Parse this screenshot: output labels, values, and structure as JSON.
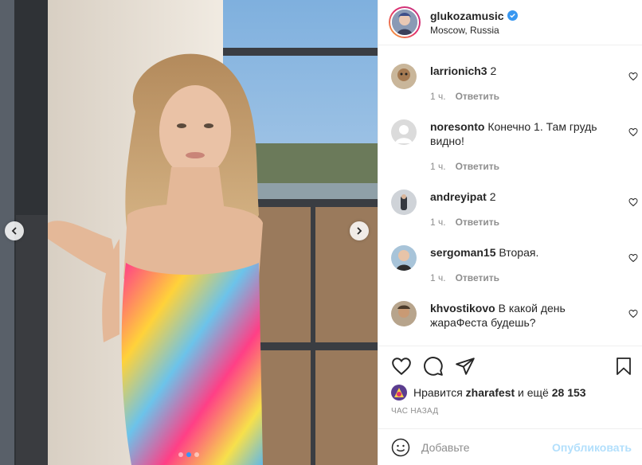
{
  "header": {
    "username": "glukozamusic",
    "location": "Moscow, Russia"
  },
  "comments": [
    {
      "username": "larrionich3",
      "text": "2",
      "time": "1 ч.",
      "reply": "Ответить"
    },
    {
      "username": "noresonto",
      "text": "Конечно 1. Там грудь видно!",
      "time": "1 ч.",
      "reply": "Ответить"
    },
    {
      "username": "andreyipat",
      "text": "2",
      "time": "1 ч.",
      "reply": "Ответить"
    },
    {
      "username": "sergoman15",
      "text": "Вторая.",
      "time": "1 ч.",
      "reply": "Ответить"
    },
    {
      "username": "khvostikovo",
      "text": "В какой день жараФеста будешь?",
      "time": "",
      "reply": ""
    }
  ],
  "likes": {
    "prefix": "Нравится",
    "user": "zharafest",
    "suffix": "и ещё",
    "count": "28 153"
  },
  "timestamp": "ЧАС НАЗАД",
  "add_comment": {
    "placeholder": "Добавьте",
    "publish": "Опубликовать"
  },
  "carousel": {
    "slides": 3,
    "active": 2
  },
  "colors": {
    "link_disabled": "#b2dffc",
    "verified": "#3897f0",
    "carousel_active": "#3b93f5"
  },
  "icons": [
    "chevron-left-icon",
    "chevron-right-icon",
    "verified-icon",
    "heart-icon",
    "comment-icon",
    "share-icon",
    "bookmark-icon",
    "emoji-icon"
  ]
}
